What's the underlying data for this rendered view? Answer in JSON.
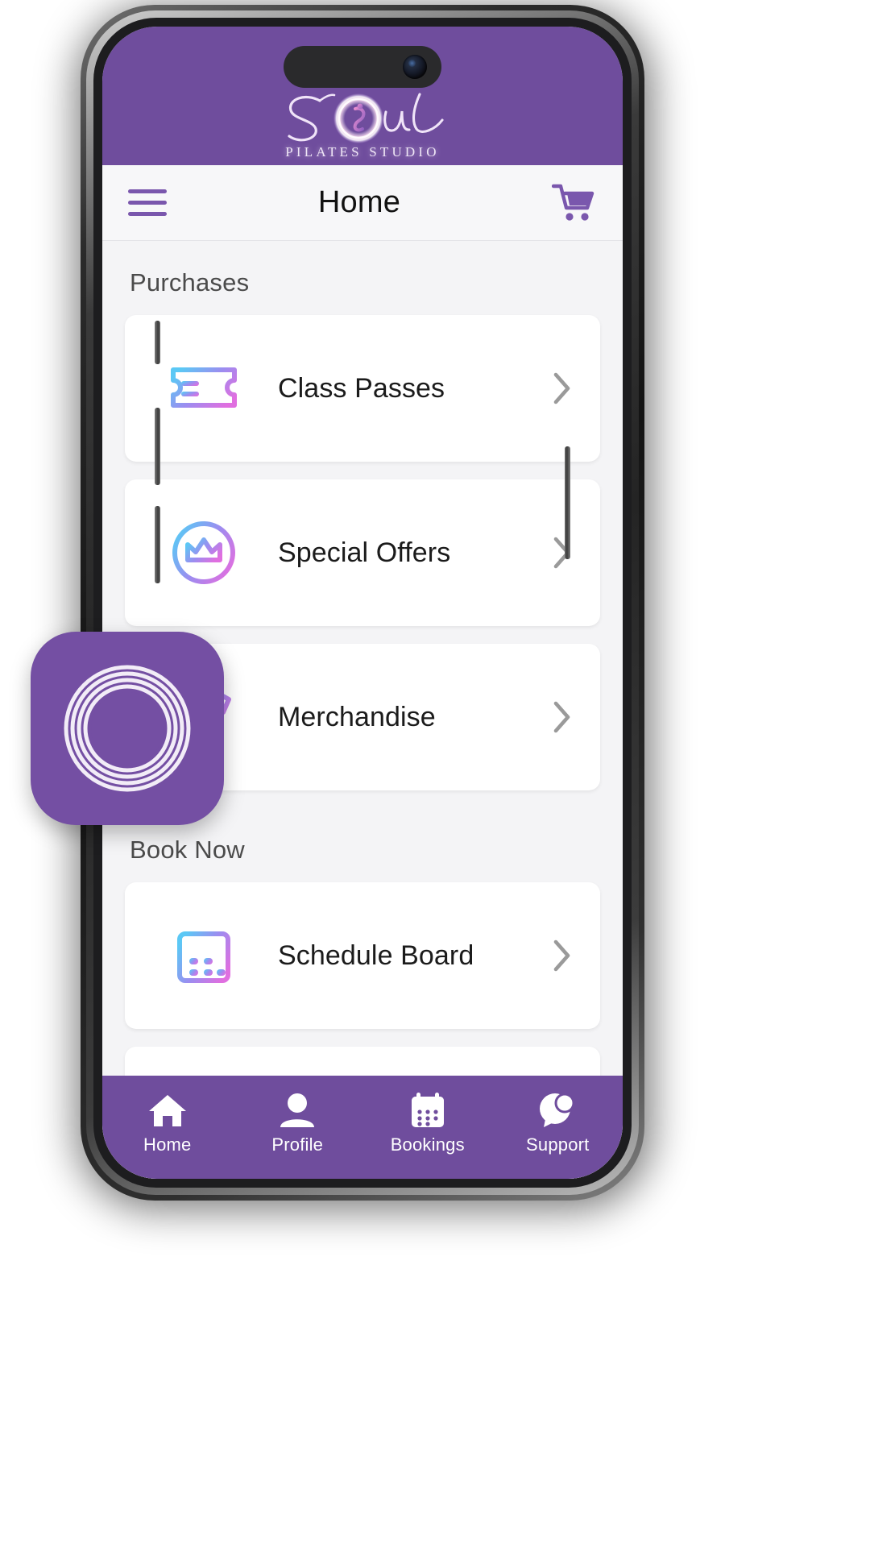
{
  "brand": {
    "logo_wordmark": "Soul",
    "logo_subtitle": "PILATES STUDIO",
    "primary_color": "#6f4d9d",
    "accent_gradient_start": "#5bc8f5",
    "accent_gradient_mid": "#9b8df0",
    "accent_gradient_end": "#e06fe0"
  },
  "appbar": {
    "menu_icon": "hamburger-menu-icon",
    "title": "Home",
    "cart_icon": "shopping-cart-icon"
  },
  "sections": [
    {
      "label": "Purchases",
      "items": [
        {
          "label": "Class Passes",
          "icon": "ticket-icon",
          "chevron": "chevron-right-icon"
        },
        {
          "label": "Special Offers",
          "icon": "crown-circle-icon",
          "chevron": "chevron-right-icon"
        },
        {
          "label": "Merchandise",
          "icon": "tshirt-icon",
          "chevron": "chevron-right-icon"
        }
      ]
    },
    {
      "label": "Book Now",
      "items": [
        {
          "label": "Schedule Board",
          "icon": "calendar-icon",
          "chevron": "chevron-right-icon"
        }
      ]
    }
  ],
  "bottom_nav": {
    "active": "Home",
    "items": [
      {
        "label": "Home",
        "icon": "house-icon"
      },
      {
        "label": "Profile",
        "icon": "person-icon"
      },
      {
        "label": "Bookings",
        "icon": "calendar-icon"
      },
      {
        "label": "Support",
        "icon": "chat-bubbles-icon"
      }
    ]
  },
  "floating_app_icon": {
    "name": "soul-pilates-app-icon",
    "background_color": "#744fa3",
    "ring_color": "#f2ecf7"
  }
}
